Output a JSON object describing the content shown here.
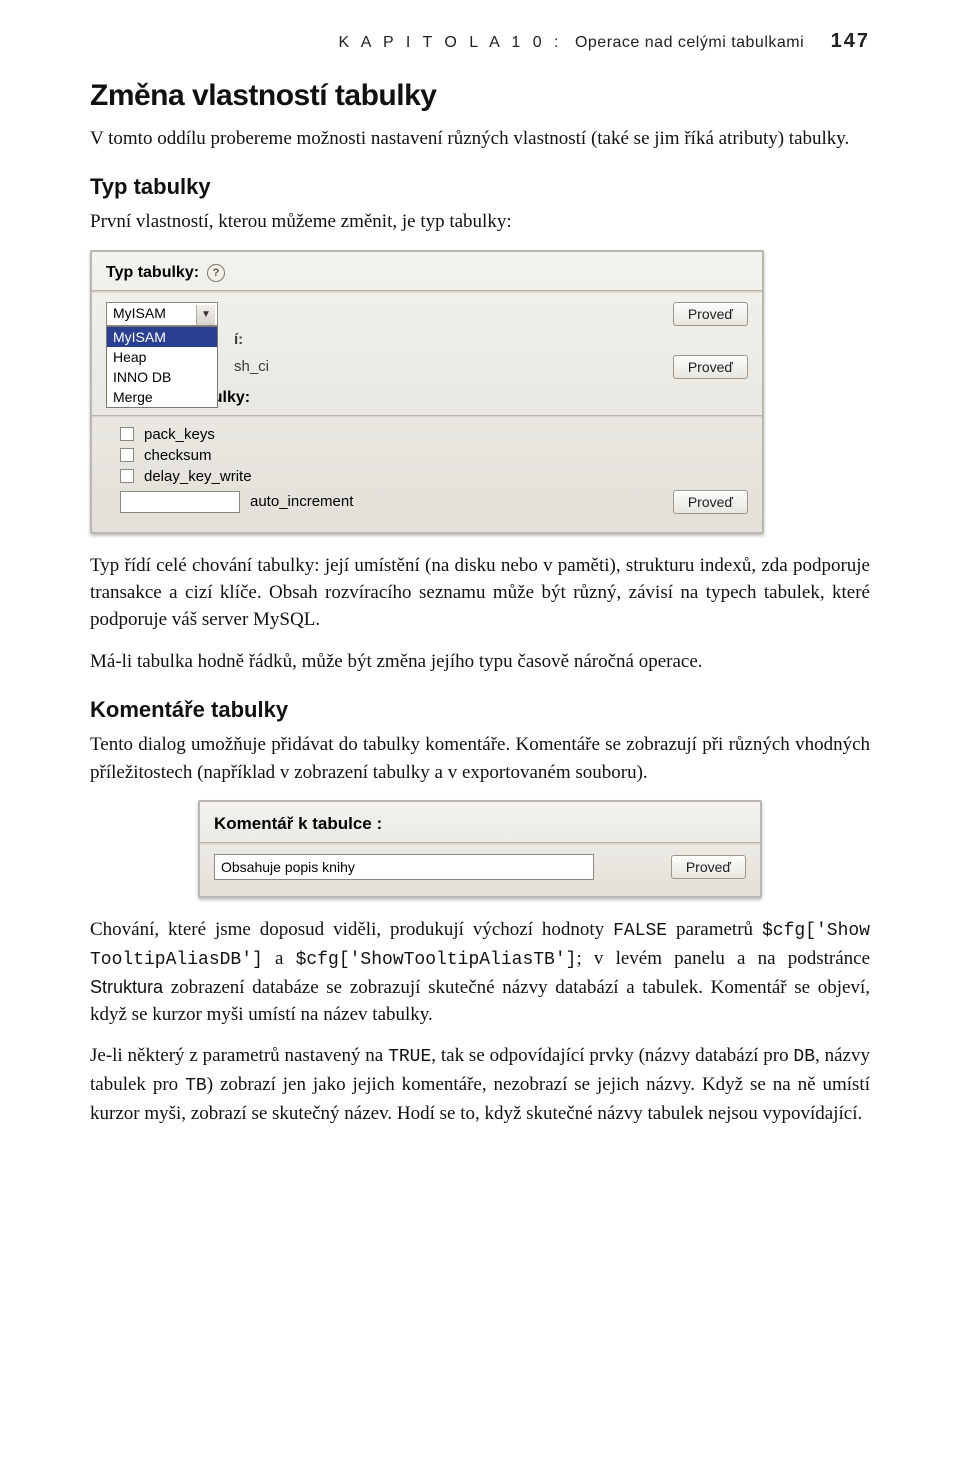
{
  "runhead": {
    "kapitola_prefix": "K A P I T O L A   1 0 :",
    "kapitola_title": "Operace nad celými tabulkami",
    "page_number": "147"
  },
  "h1": "Změna vlastností tabulky",
  "p_intro": "V tomto oddílu probereme možnosti nastavení různých vlastností (také se jim říká atributy) tabulky.",
  "h2_typ": "Typ tabulky",
  "p_typ_lead": "První vlastností, kterou můžeme změnit, je typ tabulky:",
  "panel1": {
    "title": "Typ tabulky:",
    "help_q": "?",
    "combo_value": "MyISAM",
    "combo_options": [
      "MyISAM",
      "Heap",
      "INNO DB",
      "Merge"
    ],
    "collation_label_suffix": "í:",
    "collation_value_suffix": "sh_ci",
    "params_title": "Parametry tabulky:",
    "checkboxes": [
      "pack_keys",
      "checksum",
      "delay_key_write"
    ],
    "auto_inc_label": "auto_increment",
    "btn_proved": "Proveď"
  },
  "p_typ_after1": "Typ řídí celé chování tabulky: její umístění (na disku nebo v paměti), strukturu indexů, zda podporuje transakce a cizí klíče. Obsah rozvíracího seznamu může být různý, závisí na typech tabulek, které podporuje váš server MySQL.",
  "p_typ_after2": "Má-li tabulka hodně řádků, může být změna jejího typu časově náročná operace.",
  "h2_komentare": "Komentáře tabulky",
  "p_kom_lead": "Tento dialog umožňuje přidávat do tabulky komentáře. Komentáře se zobrazují při různých vhodných příležitostech (například v zobrazení tabulky a v exportovaném souboru).",
  "panel2": {
    "title": "Komentář k tabulce :",
    "input_value": "Obsahuje popis knihy",
    "btn_proved": "Proveď"
  },
  "p_chov1_a": "Chování, které jsme doposud viděli, produkují výchozí hodnoty ",
  "p_chov1_code1": "FALSE",
  "p_chov1_b": " parametrů ",
  "p_chov1_code2": "$cfg['Show TooltipAliasDB']",
  "p_chov1_c": " a ",
  "p_chov1_code3": "$cfg['ShowTooltipAliasTB']",
  "p_chov1_d": "; v levém panelu a na podstránce ",
  "p_chov1_ui": "Struktura",
  "p_chov1_e": " zobrazení databáze se zobrazují skutečné názvy databází a tabulek. Komentář se objeví, když se kurzor myši umístí na název tabulky.",
  "p_chov2_a": "Je-li některý z parametrů nastavený na ",
  "p_chov2_code1": "TRUE",
  "p_chov2_b": ", tak se odpovídající prvky (názvy databází pro ",
  "p_chov2_code2": "DB",
  "p_chov2_c": ", názvy tabulek pro ",
  "p_chov2_code3": "TB",
  "p_chov2_d": ") zobrazí jen jako jejich komentáře, nezobrazí se jejich názvy. Když se na ně umístí kurzor myši, zobrazí se skutečný název. Hodí se to, když skutečné názvy tabulek nejsou vypovídající."
}
